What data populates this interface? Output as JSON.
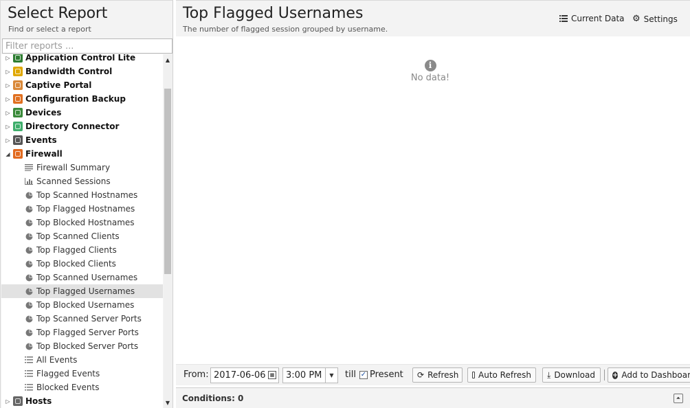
{
  "sidebar": {
    "title": "Select Report",
    "subtitle": "Find or select a report",
    "filter_placeholder": "Filter reports ...",
    "apps": [
      {
        "label": "Application Control Lite",
        "icon": "app-control-lite-icon",
        "color": "#2e7d32",
        "expanded": false
      },
      {
        "label": "Bandwidth Control",
        "icon": "bandwidth-control-icon",
        "color": "#e0a800",
        "expanded": false
      },
      {
        "label": "Captive Portal",
        "icon": "captive-portal-icon",
        "color": "#d9893a",
        "expanded": false
      },
      {
        "label": "Configuration Backup",
        "icon": "configuration-backup-icon",
        "color": "#e07020",
        "expanded": false
      },
      {
        "label": "Devices",
        "icon": "devices-icon",
        "color": "#3a8a3a",
        "expanded": false
      },
      {
        "label": "Directory Connector",
        "icon": "directory-connector-icon",
        "color": "#3fae6c",
        "expanded": false
      },
      {
        "label": "Events",
        "icon": "events-icon",
        "color": "#555555",
        "expanded": false
      },
      {
        "label": "Firewall",
        "icon": "firewall-icon",
        "color": "#e26a1f",
        "expanded": true
      }
    ],
    "firewall_reports": [
      {
        "label": "Firewall Summary",
        "icon": "text-lines-icon"
      },
      {
        "label": "Scanned Sessions",
        "icon": "bar-chart-icon"
      },
      {
        "label": "Top Scanned Hostnames",
        "icon": "pie-chart-icon"
      },
      {
        "label": "Top Flagged Hostnames",
        "icon": "pie-chart-icon"
      },
      {
        "label": "Top Blocked Hostnames",
        "icon": "pie-chart-icon"
      },
      {
        "label": "Top Scanned Clients",
        "icon": "pie-chart-icon"
      },
      {
        "label": "Top Flagged Clients",
        "icon": "pie-chart-icon"
      },
      {
        "label": "Top Blocked Clients",
        "icon": "pie-chart-icon"
      },
      {
        "label": "Top Scanned Usernames",
        "icon": "pie-chart-icon"
      },
      {
        "label": "Top Flagged Usernames",
        "icon": "pie-chart-icon",
        "selected": true
      },
      {
        "label": "Top Blocked Usernames",
        "icon": "pie-chart-icon"
      },
      {
        "label": "Top Scanned Server Ports",
        "icon": "pie-chart-icon"
      },
      {
        "label": "Top Flagged Server Ports",
        "icon": "pie-chart-icon"
      },
      {
        "label": "Top Blocked Server Ports",
        "icon": "pie-chart-icon"
      },
      {
        "label": "All Events",
        "icon": "list-icon"
      },
      {
        "label": "Flagged Events",
        "icon": "list-icon"
      },
      {
        "label": "Blocked Events",
        "icon": "list-icon"
      }
    ],
    "after_apps": [
      {
        "label": "Hosts",
        "icon": "hosts-icon",
        "color": "#666666",
        "expanded": false
      }
    ]
  },
  "report": {
    "title": "Top Flagged Usernames",
    "subtitle": "The number of flagged session grouped by username.",
    "current_data_label": "Current Data",
    "settings_label": "Settings",
    "empty_text": "No data!"
  },
  "toolbar": {
    "from_label": "From:",
    "date_value": "2017-06-06",
    "time_value": "3:00 PM",
    "till_label": "till",
    "present_label": "Present",
    "present_checked": true,
    "refresh_label": "Refresh",
    "auto_refresh_label": "Auto Refresh",
    "download_label": "Download",
    "add_dashboard_label": "Add to Dashboard"
  },
  "conditions": {
    "label": "Conditions: 0"
  }
}
